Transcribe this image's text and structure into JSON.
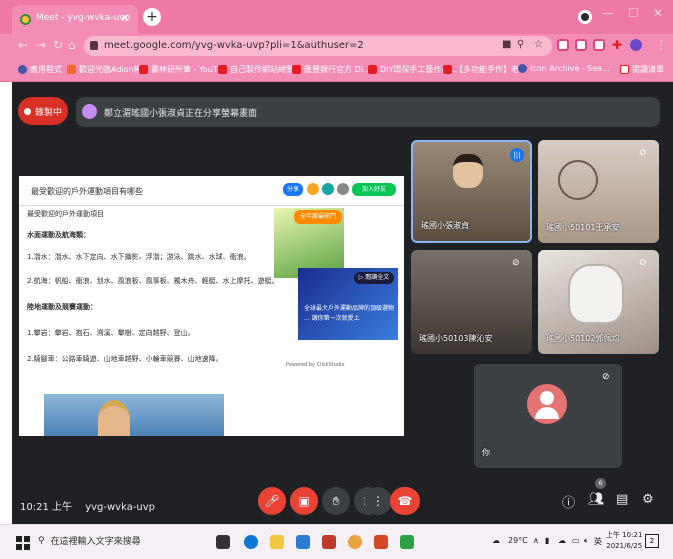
{
  "browser": {
    "tab_title": "Meet - yvg-wvka-uvp",
    "tab_close": "✕",
    "new_tab": "+",
    "url": "meet.google.com/yvg-wvka-uvp?pli=1&authuser=2",
    "bookmarks": [
      {
        "label": "應用程式",
        "icon": "apps-icon"
      },
      {
        "label": "歡迎光臨Adion帳...",
        "icon": "page-icon"
      },
      {
        "label": "書林研所筆 - YouT...",
        "icon": "youtube-icon"
      },
      {
        "label": "自己製作網站總覽...",
        "icon": "youtube-icon"
      },
      {
        "label": "匯豐銀行官方 DI...",
        "icon": "youtube-icon"
      },
      {
        "label": "DIY環保手工藝作品...",
        "icon": "youtube-icon"
      },
      {
        "label": "【多功能手作】老...",
        "icon": "youtube-icon"
      },
      {
        "label": "Icon Archive - Sea...",
        "icon": "globe-icon"
      },
      {
        "label": "閱讀清單",
        "icon": "reading-list-icon"
      }
    ]
  },
  "meet": {
    "recording_label": "錄製中",
    "share_banner": "鄭立湄瑤國小張淑貞正在分享螢幕畫面",
    "meeting_time": "10:21 上午",
    "meeting_code": "yvg-wvka-uvp",
    "people_count": "6",
    "presentation": {
      "title": "最受歡迎的戶外運動項目有哪些",
      "share_btn": "分享",
      "join_btn": "加入好友",
      "lines": [
        {
          "text": "最受歡迎的戶外運動項目",
          "bold": false
        },
        {
          "text": "水面運動及航海類：",
          "bold": true
        },
        {
          "text": "1.潛水：潛水、水下定向、水下攝影、浮潛；游泳、跳水、水球、衝浪。",
          "bold": false
        },
        {
          "text": "2.航海：帆船、衝浪、划水、風浪板、風箏板、獨木舟、輕艇、水上摩托、遊艇。",
          "bold": false
        },
        {
          "text": "陸地運動及競賽運動：",
          "bold": true
        },
        {
          "text": "1.攀岩：攀岩、抱石、溯溪、攀樹、定向越野、登山。",
          "bold": false
        },
        {
          "text": "2.騎腳車：公路車騎遊、山地車越野、小輪車競賽、山地速降。",
          "bold": false
        }
      ],
      "ad_badge": "全年度最熱門",
      "ad_button": "▷ 閱讀全文",
      "ad_text": "全球最大戶外運動品牌的頂級選物 ... 讓你第一次就愛上",
      "ad_footer": "Powered by ClickStudio"
    },
    "tiles": [
      {
        "name": "瑤國小張淑貞",
        "state": "speaking"
      },
      {
        "name": "瑤國小50101王承安",
        "state": "muted"
      },
      {
        "name": "瑤國小50103陳沁安",
        "state": "muted"
      },
      {
        "name": "瑤國小50102郭佩均",
        "state": "muted"
      },
      {
        "name": "你",
        "state": "muted"
      }
    ]
  },
  "taskbar": {
    "search_placeholder": "在這裡輸入文字來搜尋",
    "weather": "29°C",
    "ime": "英",
    "clock_time": "上午 10:21",
    "clock_date": "2021/6/25",
    "notifications": "2"
  }
}
